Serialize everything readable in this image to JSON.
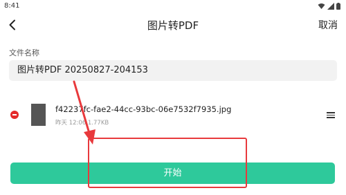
{
  "status_bar": {
    "time": "8:41",
    "icons": [
      "wifi-icon",
      "signal-icon",
      "battery-icon"
    ]
  },
  "toolbar": {
    "back_icon": "chevron-left-icon",
    "title": "图片转PDF",
    "cancel_label": "取消"
  },
  "form": {
    "file_name_label": "文件名称",
    "file_name_value": "图片转PDF 20250827-204153"
  },
  "files": [
    {
      "name": "f42237fc-fae2-44cc-93bc-06e7532f7935.jpg",
      "meta": "昨天 12:06 1.77KB"
    }
  ],
  "actions": {
    "start_label": "开始"
  },
  "colors": {
    "accent": "#2ec99b",
    "remove": "#e42a2a",
    "annotation": "#e8393c"
  }
}
